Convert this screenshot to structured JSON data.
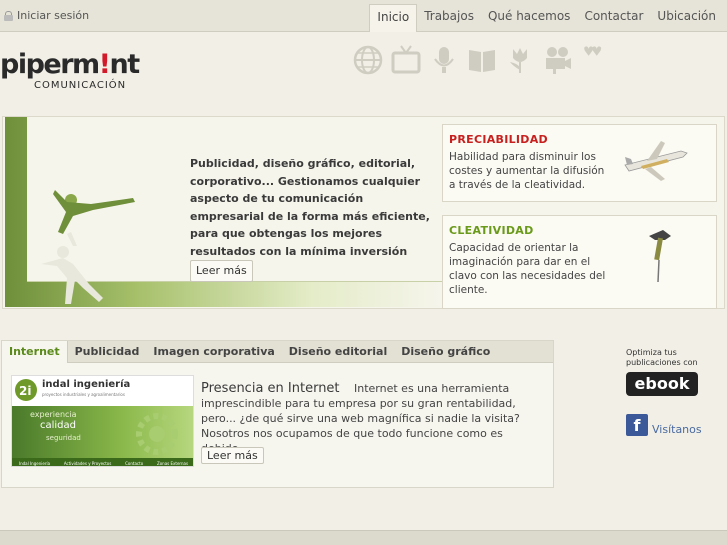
{
  "header": {
    "login_label": "Iniciar sesión",
    "nav": [
      "Inicio",
      "Trabajos",
      "Qué hacemos",
      "Contactar",
      "Ubicación"
    ]
  },
  "logo": {
    "brand_part1": "piperm",
    "brand_dot": "!",
    "brand_part2": "nt",
    "subtitle": "COMUNICACIÓN"
  },
  "icons": [
    "globe-icon",
    "tv-icon",
    "microphone-icon",
    "book-icon",
    "tulip-icon",
    "film-camera-icon",
    "hearts-icon"
  ],
  "hero": {
    "text": "Publicidad, diseño gráfico, editorial, corporativo... Gestionamos cualquier aspecto de tu comunicación empresarial de la forma más eficiente, para que obtengas los mejores resultados con la mínima inversión",
    "button": "Leer más",
    "cards": [
      {
        "title": "PRECIABILIDAD",
        "text": "Habilidad para disminuir los costes y aumentar la difusión a través de la cleatividad."
      },
      {
        "title": "CLEATIVIDAD",
        "text": "Capacidad de orientar la imaginación para dar en el clavo con las necesidades del cliente."
      }
    ]
  },
  "tabs": {
    "items": [
      "Internet",
      "Publicidad",
      "Imagen corporativa",
      "Diseño editorial",
      "Diseño gráfico"
    ],
    "feature": {
      "title": "Presencia en Internet",
      "text": "Internet es una herramienta imprescindible para tu empresa por su gran rentabilidad, pero... ¿de qué sirve una web magnífica si nadie la visita? Nosotros nos ocupamos de que todo funcione como es debido.",
      "button": "Leer más",
      "thumb": {
        "company": "indal ingeniería",
        "tagline": "proyectos industriales y agroalimentarios",
        "words": [
          "experiencia",
          "calidad",
          "seguridad"
        ],
        "menu": [
          "Indal Ingeniería",
          "Actividades y Proyectos",
          "Contacto",
          "Zonas Externas"
        ]
      }
    }
  },
  "sidebar": {
    "note": "Optimiza tus publicaciones con",
    "ebook": "ebook",
    "facebook_letter": "f",
    "visit": "Visítanos"
  },
  "colors": {
    "accent_red": "#c8201e",
    "accent_green": "#6a9a1a",
    "background": "#f1efe6"
  }
}
